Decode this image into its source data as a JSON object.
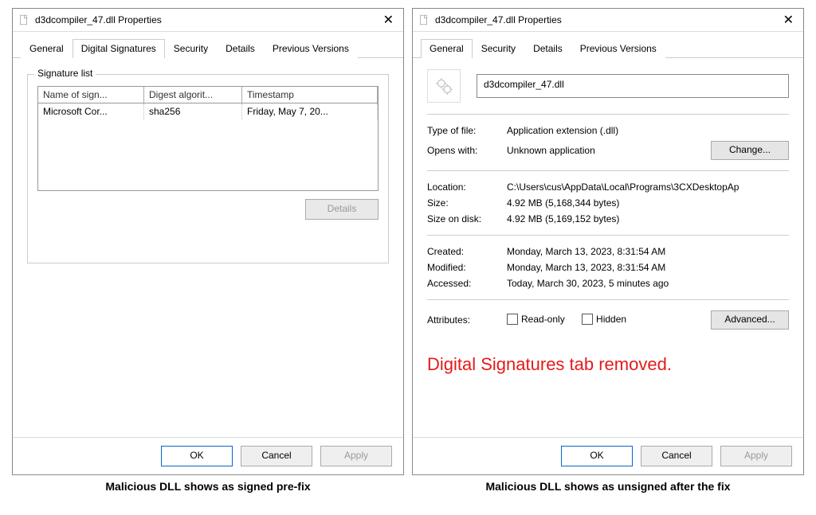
{
  "left": {
    "title": "d3dcompiler_47.dll Properties",
    "tabs": [
      "General",
      "Digital Signatures",
      "Security",
      "Details",
      "Previous Versions"
    ],
    "activeTab": 1,
    "sigList": {
      "legend": "Signature list",
      "headers": [
        "Name of sign...",
        "Digest algorit...",
        "Timestamp"
      ],
      "row": {
        "name": "Microsoft Cor...",
        "digest": "sha256",
        "ts": "Friday, May 7, 20..."
      },
      "detailsBtn": "Details"
    },
    "footer": {
      "ok": "OK",
      "cancel": "Cancel",
      "apply": "Apply"
    },
    "caption": "Malicious DLL shows as signed pre-fix"
  },
  "right": {
    "title": "d3dcompiler_47.dll Properties",
    "tabs": [
      "General",
      "Security",
      "Details",
      "Previous Versions"
    ],
    "activeTab": 0,
    "filename": "d3dcompiler_47.dll",
    "labels": {
      "type": "Type of file:",
      "opens": "Opens with:",
      "change": "Change...",
      "location": "Location:",
      "size": "Size:",
      "sod": "Size on disk:",
      "created": "Created:",
      "modified": "Modified:",
      "accessed": "Accessed:",
      "attributes": "Attributes:",
      "readonly": "Read-only",
      "hidden": "Hidden",
      "advanced": "Advanced..."
    },
    "values": {
      "type": "Application extension (.dll)",
      "opens": "Unknown application",
      "location": "C:\\Users\\cus\\AppData\\Local\\Programs\\3CXDesktopAp",
      "size": "4.92 MB (5,168,344 bytes)",
      "sod": "4.92 MB (5,169,152 bytes)",
      "created": "Monday, March 13, 2023, 8:31:54 AM",
      "modified": "Monday, March 13, 2023, 8:31:54 AM",
      "accessed": "Today, March 30, 2023, 5 minutes ago"
    },
    "annotation": "Digital Signatures tab removed.",
    "footer": {
      "ok": "OK",
      "cancel": "Cancel",
      "apply": "Apply"
    },
    "caption": "Malicious DLL shows as unsigned after the fix"
  }
}
